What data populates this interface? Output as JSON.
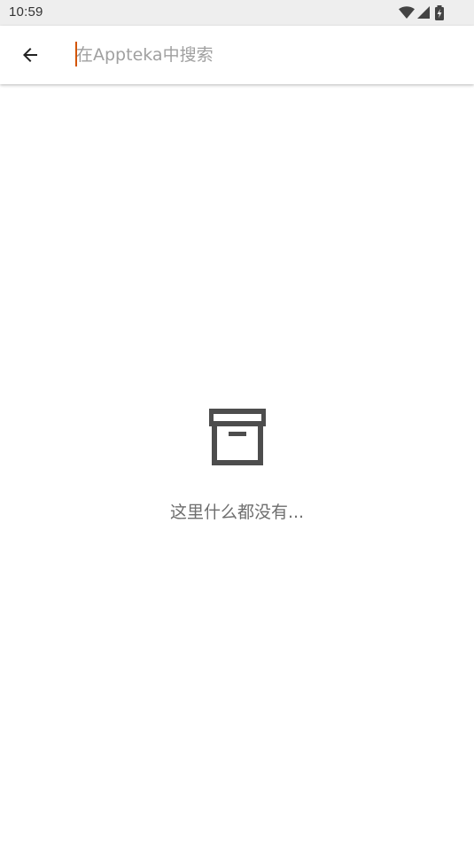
{
  "status_bar": {
    "time": "10:59",
    "icons": [
      "wifi-icon",
      "cellular-signal-icon",
      "battery-charging-icon"
    ]
  },
  "app_bar": {
    "back_icon": "arrow-left-icon",
    "search": {
      "placeholder": "在Appteka中搜索",
      "value": ""
    },
    "caret_color": "#d35400"
  },
  "empty_state": {
    "icon": "archive-box-icon",
    "message": "这里什么都没有..."
  }
}
